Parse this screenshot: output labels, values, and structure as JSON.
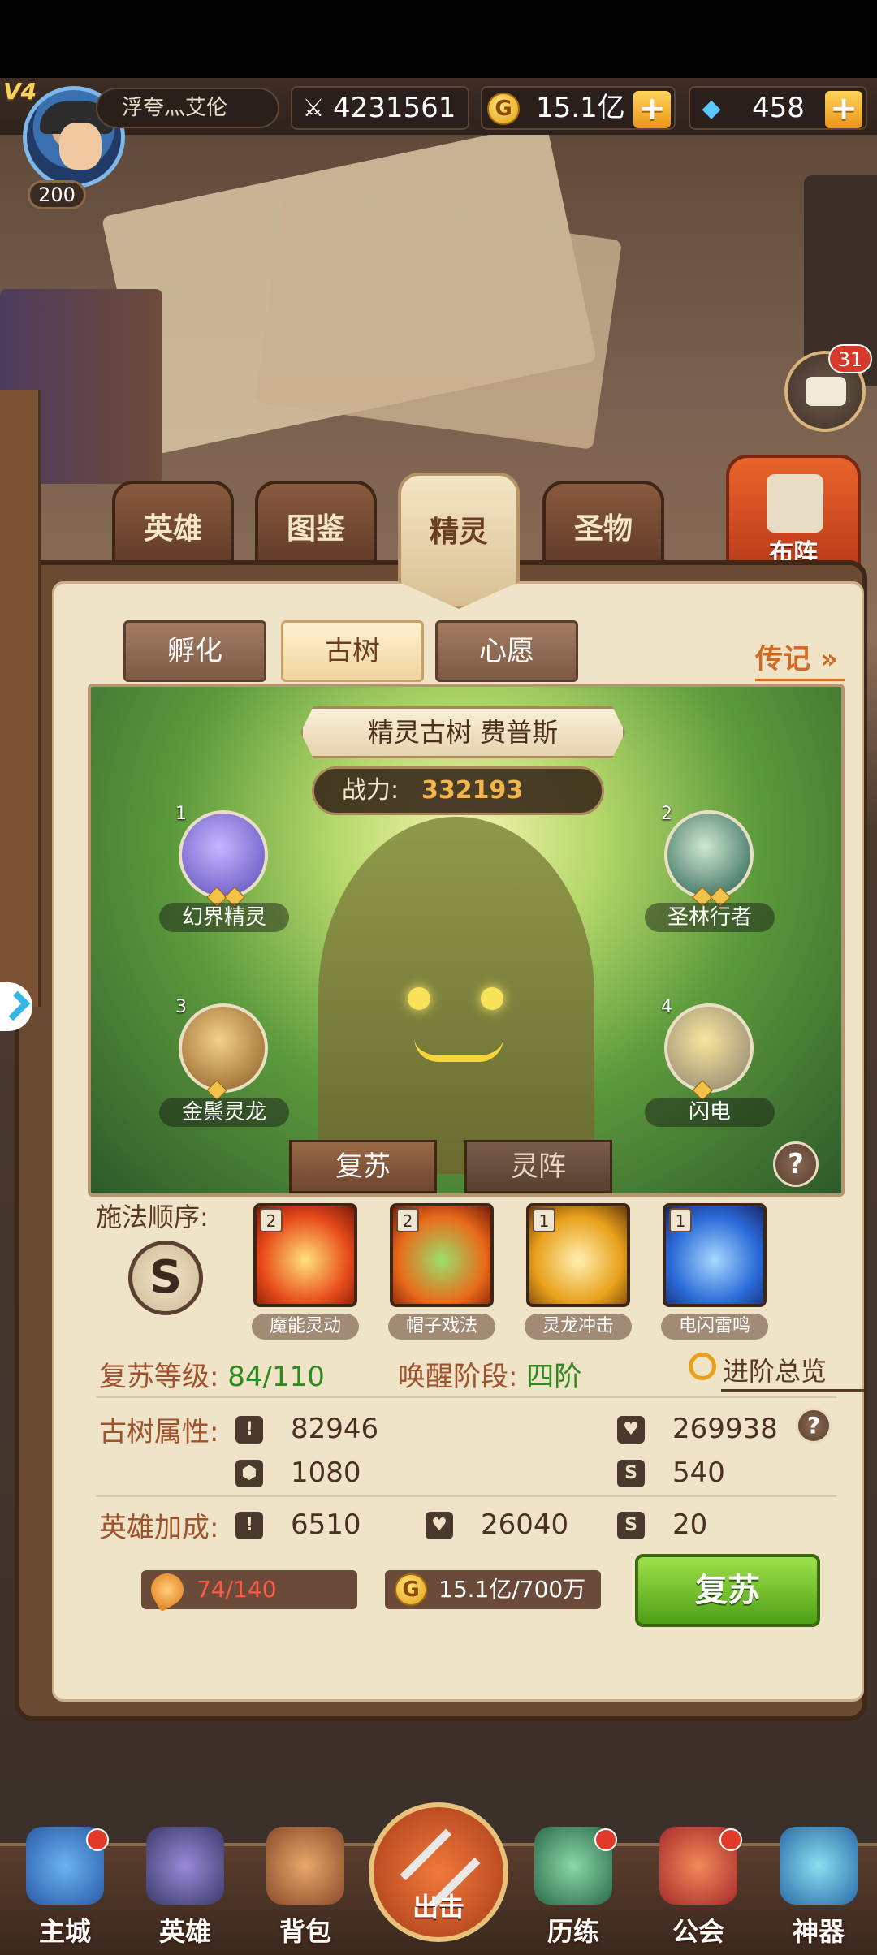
{
  "player": {
    "vip": "V4",
    "level": "200",
    "name": "浮夸灬艾伦"
  },
  "resources": {
    "power": "4231561",
    "gold": "15.1亿",
    "gems": "458",
    "plus": "+"
  },
  "chat": {
    "badge": "31"
  },
  "main_tabs": [
    {
      "label": "英雄"
    },
    {
      "label": "图鉴"
    },
    {
      "label": "精灵"
    },
    {
      "label": "圣物"
    }
  ],
  "formation": {
    "label": "布阵"
  },
  "sub_tabs": [
    {
      "label": "孵化"
    },
    {
      "label": "古树"
    },
    {
      "label": "心愿"
    }
  ],
  "legend_link": "传记",
  "tree": {
    "title": "精灵古树 费普斯",
    "power_label": "战力:",
    "power_value": "332193"
  },
  "spirits": [
    {
      "slot": "1",
      "name": "幻界精灵"
    },
    {
      "slot": "2",
      "name": "圣林行者"
    },
    {
      "slot": "3",
      "name": "金鬃灵龙"
    },
    {
      "slot": "4",
      "name": "闪电"
    }
  ],
  "scene_tabs": {
    "revive": "复苏",
    "array": "灵阵"
  },
  "help": "?",
  "cast": {
    "label": "施法顺序:",
    "cycle_symbol": "S",
    "skills": [
      {
        "count": "2",
        "name": "魔能灵动"
      },
      {
        "count": "2",
        "name": "帽子戏法"
      },
      {
        "count": "1",
        "name": "灵龙冲击"
      },
      {
        "count": "1",
        "name": "电闪雷鸣"
      }
    ]
  },
  "revive_level": {
    "label": "复苏等级:",
    "value": "84/110"
  },
  "awaken": {
    "label": "唤醒阶段:",
    "value": "四阶"
  },
  "advance_overview": "进阶总览",
  "tree_attrs": {
    "label": "古树属性:",
    "atk": "82946",
    "hp": "269938",
    "def": "1080",
    "spd": "540"
  },
  "hero_bonus": {
    "label": "英雄加成:",
    "atk": "6510",
    "hp": "26040",
    "spd": "20"
  },
  "cost": {
    "material": "74/140",
    "gold": "15.1亿/700万"
  },
  "revive_button": "复苏",
  "bottom_nav": [
    {
      "label": "主城"
    },
    {
      "label": "英雄"
    },
    {
      "label": "背包"
    },
    {
      "label": "出击"
    },
    {
      "label": "历练"
    },
    {
      "label": "公会"
    },
    {
      "label": "神器"
    }
  ]
}
